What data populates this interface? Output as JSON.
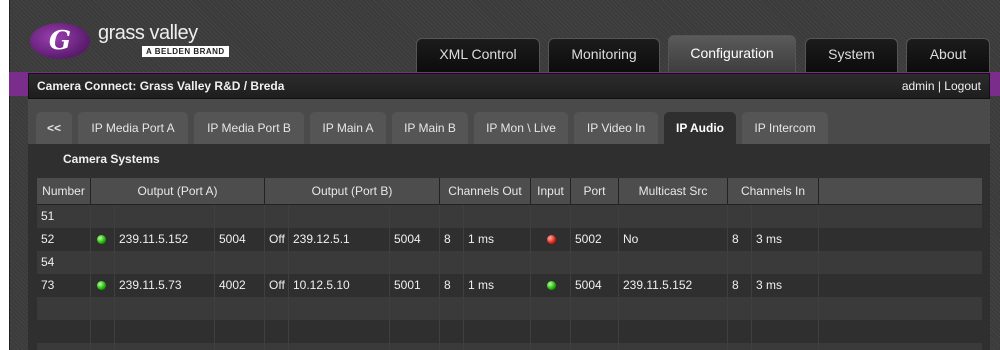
{
  "logo": {
    "name": "grass valley",
    "brand": "A BELDEN BRAND",
    "mark": "G"
  },
  "top_tabs": [
    "XML Control",
    "Monitoring",
    "Configuration",
    "System",
    "About"
  ],
  "active_top_tab": "Configuration",
  "header": {
    "title": "Camera Connect: Grass Valley R&D / Breda",
    "user": "admin | Logout"
  },
  "sub_tabs": [
    "<<",
    "IP Media Port A",
    "IP Media Port B",
    "IP Main A",
    "IP Main B",
    "IP Mon \\ Live",
    "IP Video In",
    "IP Audio",
    "IP Intercom"
  ],
  "active_sub_tab": "IP Audio",
  "section_title": "Camera Systems",
  "table": {
    "headers": [
      "Number",
      "Output (Port A)",
      "Output (Port B)",
      "Channels Out",
      "Input",
      "Port",
      "Multicast Src",
      "Channels In"
    ],
    "rows": [
      {
        "number": "51",
        "a_status": "",
        "a_ip": "",
        "a_port": "",
        "b_state": "",
        "b_ip": "",
        "b_port": "",
        "ch_out": "",
        "ch_out_delay": "",
        "input": "",
        "port": "",
        "mcast": "",
        "ch_in": "",
        "ch_in_delay": ""
      },
      {
        "number": "52",
        "a_status": "green",
        "a_ip": "239.11.5.152",
        "a_port": "5004",
        "b_state": "Off",
        "b_ip": "239.12.5.1",
        "b_port": "5004",
        "ch_out": "8",
        "ch_out_delay": "1 ms",
        "input": "red",
        "port": "5002",
        "mcast": "No",
        "ch_in": "8",
        "ch_in_delay": "3 ms"
      },
      {
        "number": "54",
        "a_status": "",
        "a_ip": "",
        "a_port": "",
        "b_state": "",
        "b_ip": "",
        "b_port": "",
        "ch_out": "",
        "ch_out_delay": "",
        "input": "",
        "port": "",
        "mcast": "",
        "ch_in": "",
        "ch_in_delay": ""
      },
      {
        "number": "73",
        "a_status": "green",
        "a_ip": "239.11.5.73",
        "a_port": "4002",
        "b_state": "Off",
        "b_ip": "10.12.5.10",
        "b_port": "5001",
        "ch_out": "8",
        "ch_out_delay": "1 ms",
        "input": "green",
        "port": "5004",
        "mcast": "239.11.5.152",
        "ch_in": "8",
        "ch_in_delay": "3 ms"
      },
      {
        "number": "",
        "a_status": "",
        "a_ip": "",
        "a_port": "",
        "b_state": "",
        "b_ip": "",
        "b_port": "",
        "ch_out": "",
        "ch_out_delay": "",
        "input": "",
        "port": "",
        "mcast": "",
        "ch_in": "",
        "ch_in_delay": ""
      },
      {
        "number": "",
        "a_status": "",
        "a_ip": "",
        "a_port": "",
        "b_state": "",
        "b_ip": "",
        "b_port": "",
        "ch_out": "",
        "ch_out_delay": "",
        "input": "",
        "port": "",
        "mcast": "",
        "ch_in": "",
        "ch_in_delay": ""
      },
      {
        "number": "",
        "a_status": "",
        "a_ip": "",
        "a_port": "",
        "b_state": "",
        "b_ip": "",
        "b_port": "",
        "ch_out": "",
        "ch_out_delay": "",
        "input": "",
        "port": "",
        "mcast": "",
        "ch_in": "",
        "ch_in_delay": ""
      }
    ]
  },
  "colors": {
    "status_green": "#19b000",
    "status_red": "#e01d10",
    "accent_purple": "#7a2d8a"
  }
}
